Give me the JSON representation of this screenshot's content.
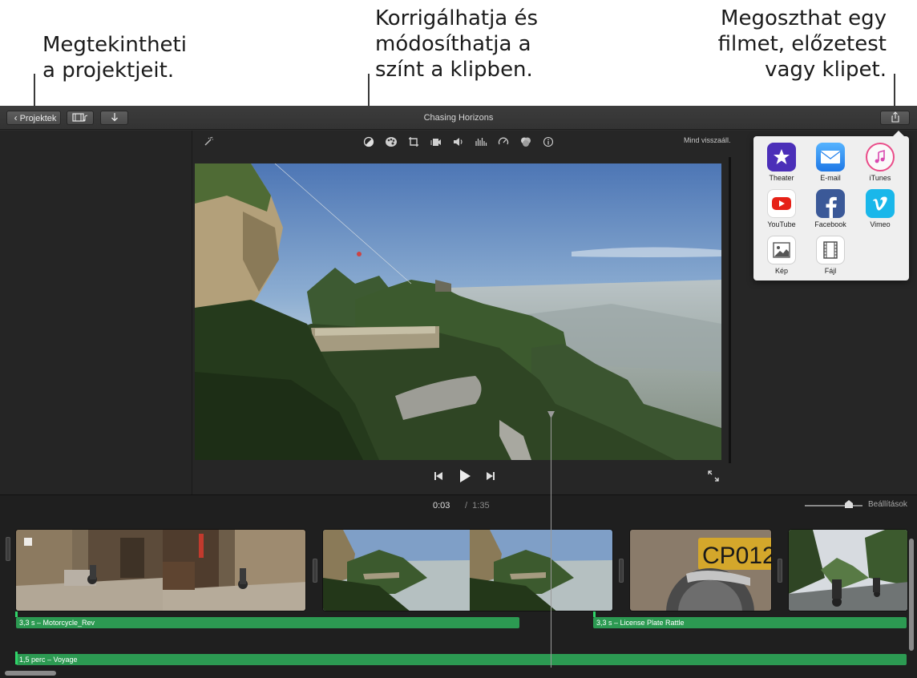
{
  "callouts": {
    "projects": "Megtekintheti\na projektjeit.",
    "color": "Korrigálhatja és\nmódosíthatja a\nszínt a klipben.",
    "share": "Megoszthat egy\nfilmet, előzetest\nvagy klipet."
  },
  "toolbar": {
    "projects_label": "Projektek",
    "project_title": "Chasing Horizons",
    "reset_all_label": "Mind visszaáll.",
    "media_icon": "film-music-icon",
    "import_icon": "down-arrow-icon",
    "share_icon": "share-icon"
  },
  "adjustments": {
    "icons": [
      "magic-wand-icon",
      "color-balance-icon",
      "color-correction-icon",
      "crop-icon",
      "stabilization-icon",
      "volume-icon",
      "equalizer-icon",
      "speed-icon",
      "filter-icon",
      "info-icon"
    ]
  },
  "share_menu": {
    "items": [
      {
        "label": "Theater",
        "icon": "theater-icon",
        "color": "#5b3fc7"
      },
      {
        "label": "E-mail",
        "icon": "mail-icon",
        "color": "#2f8cf2"
      },
      {
        "label": "iTunes",
        "icon": "itunes-icon",
        "color": "#ea4c89"
      },
      {
        "label": "YouTube",
        "icon": "youtube-icon",
        "color": "#e62117"
      },
      {
        "label": "Facebook",
        "icon": "facebook-icon",
        "color": "#3b5998"
      },
      {
        "label": "Vimeo",
        "icon": "vimeo-icon",
        "color": "#1ab7ea"
      },
      {
        "label": "Kép",
        "icon": "image-icon",
        "color": "#7f7f7f"
      },
      {
        "label": "Fájl",
        "icon": "file-icon",
        "color": "#5a5a5a"
      }
    ]
  },
  "timeline": {
    "current_time": "0:03",
    "total_time": "1:35",
    "settings_label": "Beállítások",
    "audio_clips": [
      {
        "label": "3,3 s – Motorcycle_Rev"
      },
      {
        "label": "3,3 s – License Plate Rattle"
      },
      {
        "label": "1,5 perc – Voyage"
      }
    ]
  },
  "colors": {
    "audio_green": "#2c9a52",
    "background_dark": "#2b2b2b"
  }
}
